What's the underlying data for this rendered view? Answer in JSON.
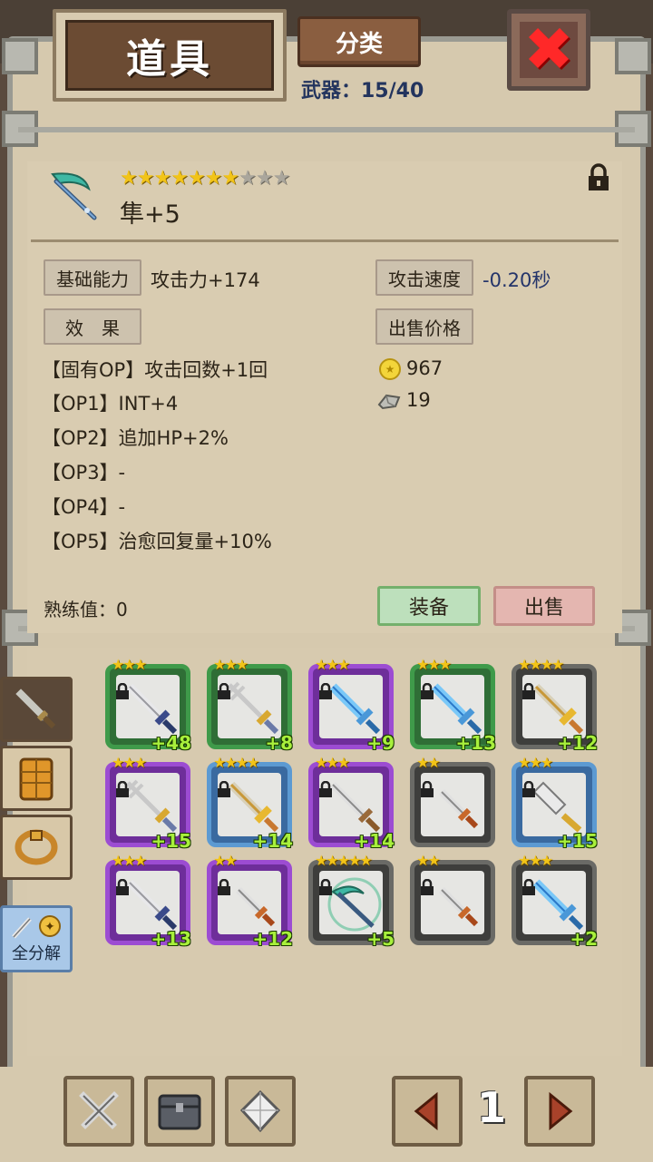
{
  "header": {
    "title": "道具",
    "category_label": "分类",
    "weapon_count_label": "武器：15/40"
  },
  "item": {
    "stars_filled": 7,
    "stars_total": 10,
    "name": "隼+5",
    "locked": true
  },
  "stats": {
    "base_label": "基础能力",
    "base_value": "攻击力+174",
    "speed_label": "攻击速度",
    "speed_value": "-0.20秒",
    "effect_label": "效　果",
    "price_label": "出售价格",
    "price_coins": "967",
    "price_stones": "19",
    "options": [
      "【固有OP】攻击回数+1回",
      "【OP1】INT+4",
      "【OP2】追加HP+2%",
      "【OP3】-",
      "【OP4】-",
      "【OP5】治愈回复量+10%"
    ],
    "mastery_label": "熟练值：0"
  },
  "actions": {
    "equip_label": "装备",
    "sell_label": "出售"
  },
  "sidebar": {
    "disassemble_label": "全分解"
  },
  "grid": [
    {
      "stars": "★★★",
      "level": "+48",
      "frame": "green",
      "weapon": "sword-blue"
    },
    {
      "stars": "★★★",
      "level": "+8",
      "frame": "green",
      "weapon": "trident-gold"
    },
    {
      "stars": "★★★",
      "level": "+9",
      "frame": "purple",
      "weapon": "sword-ice"
    },
    {
      "stars": "★★★",
      "level": "+13",
      "frame": "green",
      "weapon": "sword-ice"
    },
    {
      "stars": "★★★★",
      "level": "+12",
      "frame": "gray",
      "weapon": "sword-gold"
    },
    {
      "stars": "★★★",
      "level": "+15",
      "frame": "purple",
      "weapon": "trident-gold"
    },
    {
      "stars": "★★★★",
      "level": "+14",
      "frame": "blue",
      "weapon": "sword-gold"
    },
    {
      "stars": "★★★",
      "level": "+14",
      "frame": "purple",
      "weapon": "sword-brown"
    },
    {
      "stars": "★★",
      "level": "",
      "frame": "gray",
      "weapon": "dagger-brown"
    },
    {
      "stars": "★★★",
      "level": "+15",
      "frame": "blue",
      "weapon": "cleaver"
    },
    {
      "stars": "★★★",
      "level": "+13",
      "frame": "purple",
      "weapon": "sword-blue"
    },
    {
      "stars": "★★",
      "level": "+12",
      "frame": "purple",
      "weapon": "dagger-brown"
    },
    {
      "stars": "★★★★★",
      "level": "+5",
      "frame": "gray",
      "weapon": "scythe-selected"
    },
    {
      "stars": "★★",
      "level": "",
      "frame": "gray",
      "weapon": "dagger-brown"
    },
    {
      "stars": "★★★",
      "level": "+2",
      "frame": "gray",
      "weapon": "sword-ice"
    }
  ],
  "pager": {
    "page": "1"
  },
  "colors": {
    "parchment": "#d6c9ae",
    "level_text": "#a8f03c",
    "star": "#f2c418",
    "close_red": "#ff2828"
  }
}
